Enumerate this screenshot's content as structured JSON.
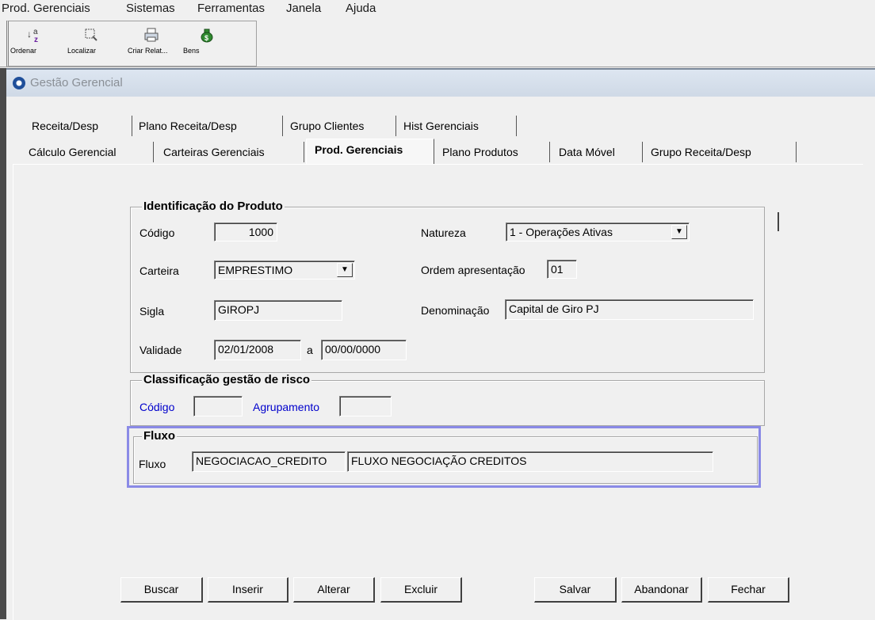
{
  "menu": [
    "Prod. Gerenciais",
    "Sistemas",
    "Ferramentas",
    "Janela",
    "Ajuda"
  ],
  "toolbar": {
    "buttons": [
      {
        "label": "Ordenar",
        "icon": "sort-az-icon"
      },
      {
        "label": "Localizar",
        "icon": "find-icon"
      },
      {
        "label": "Criar Relat...",
        "icon": "printer-icon"
      },
      {
        "label": "Bens",
        "icon": "money-bag-icon"
      }
    ]
  },
  "window": {
    "title": "Gestão Gerencial"
  },
  "tabs": {
    "row1": [
      "Receita/Desp",
      "Plano Receita/Desp",
      "Grupo Clientes",
      "Hist Gerenciais"
    ],
    "row2": [
      "Cálculo Gerencial",
      "Carteiras Gerenciais",
      "Prod. Gerenciais",
      "Plano Produtos",
      "Data Móvel",
      "Grupo Receita/Desp"
    ],
    "active": "Prod. Gerenciais"
  },
  "identificacao": {
    "title": "Identificação do Produto",
    "codigo_label": "Código",
    "codigo_value": "1000",
    "natureza_label": "Natureza",
    "natureza_value": "1 - Operações Ativas",
    "carteira_label": "Carteira",
    "carteira_value": "EMPRESTIMO",
    "ordem_label": "Ordem apresentação",
    "ordem_value": "01",
    "sigla_label": "Sigla",
    "sigla_value": "GIROPJ",
    "denominacao_label": "Denominação",
    "denominacao_value": "Capital de Giro PJ",
    "validade_label": "Validade",
    "validade_from": "02/01/2008",
    "validade_sep": "a",
    "validade_to": "00/00/0000"
  },
  "risco": {
    "title": "Classificação gestão de risco",
    "codigo_label": "Código",
    "codigo_value": "",
    "agrupamento_label": "Agrupamento",
    "agrupamento_value": ""
  },
  "fluxo": {
    "title": "Fluxo",
    "label": "Fluxo",
    "code": "NEGOCIACAO_CREDITO",
    "description": "FLUXO NEGOCIAÇÃO CREDITOS"
  },
  "buttons": {
    "buscar": "Buscar",
    "inserir": "Inserir",
    "alterar": "Alterar",
    "excluir": "Excluir",
    "salvar": "Salvar",
    "abandonar": "Abandonar",
    "fechar": "Fechar"
  }
}
